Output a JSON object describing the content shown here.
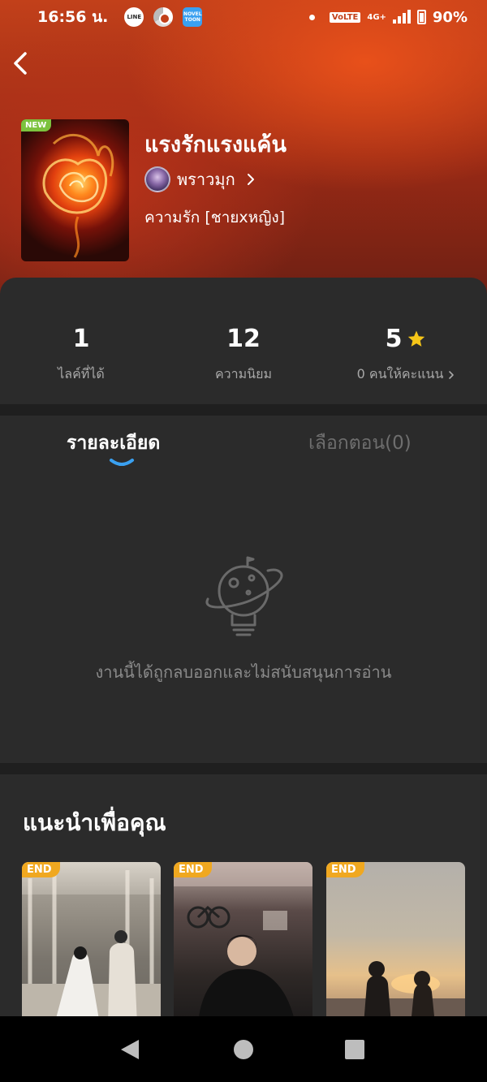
{
  "status_bar": {
    "time": "16:56 น.",
    "app_icons": [
      "LINE",
      "chrome",
      "NOVEL TOON"
    ],
    "volte": "VoLTE",
    "network": "4G+",
    "battery": "90%"
  },
  "book": {
    "badge": "NEW",
    "title": "แรงรักแรงแค้น",
    "author": "พราวมุก",
    "genre": "ความรัก [ชายxหญิง]"
  },
  "stats": [
    {
      "value": "1",
      "label": "ไลค์ที่ได้"
    },
    {
      "value": "12",
      "label": "ความนิยม"
    },
    {
      "value": "5",
      "label": "0 คนให้คะแนน"
    }
  ],
  "tabs": {
    "details": "รายละเอียด",
    "episodes": "เลือกตอน(0)"
  },
  "empty_message": "งานนี้ได้ถูกลบออกและไม่สนับสนุนการอ่าน",
  "recommend": {
    "title": "แนะนำเพื่อคุณ",
    "badge": "END"
  },
  "colors": {
    "accent_blue": "#3aa0f0",
    "star_yellow": "#f5c518",
    "end_badge": "#f0a820",
    "new_badge": "#7cc23e"
  }
}
